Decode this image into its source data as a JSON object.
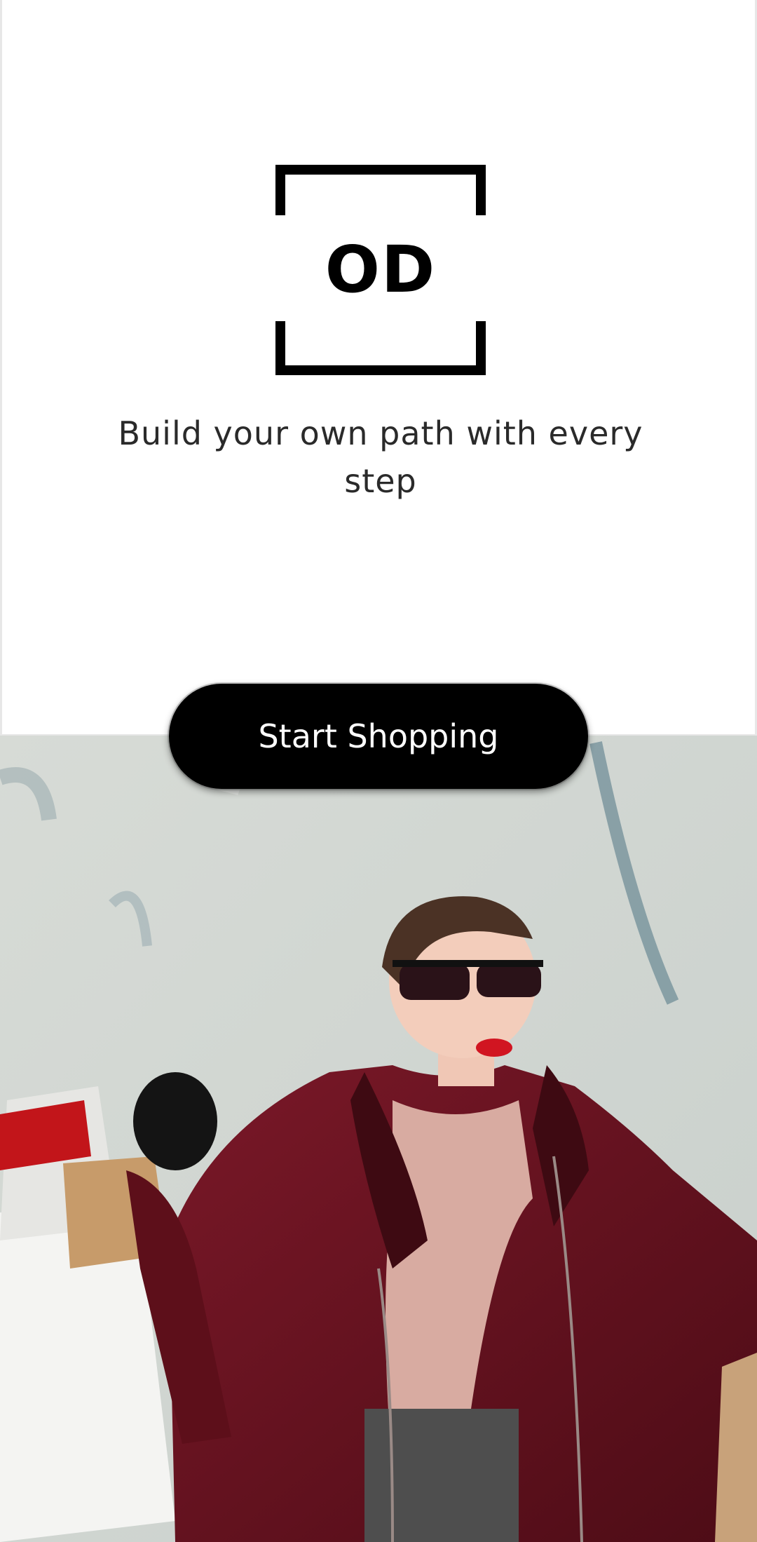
{
  "brand": {
    "logo_text": "OD"
  },
  "tagline": {
    "line1": "Build your own path with every",
    "line2": "step"
  },
  "cta": {
    "label": "Start Shopping"
  },
  "colors": {
    "background": "#ffffff",
    "button_bg": "#000000",
    "button_text": "#ffffff",
    "coat": "#6e1420"
  }
}
